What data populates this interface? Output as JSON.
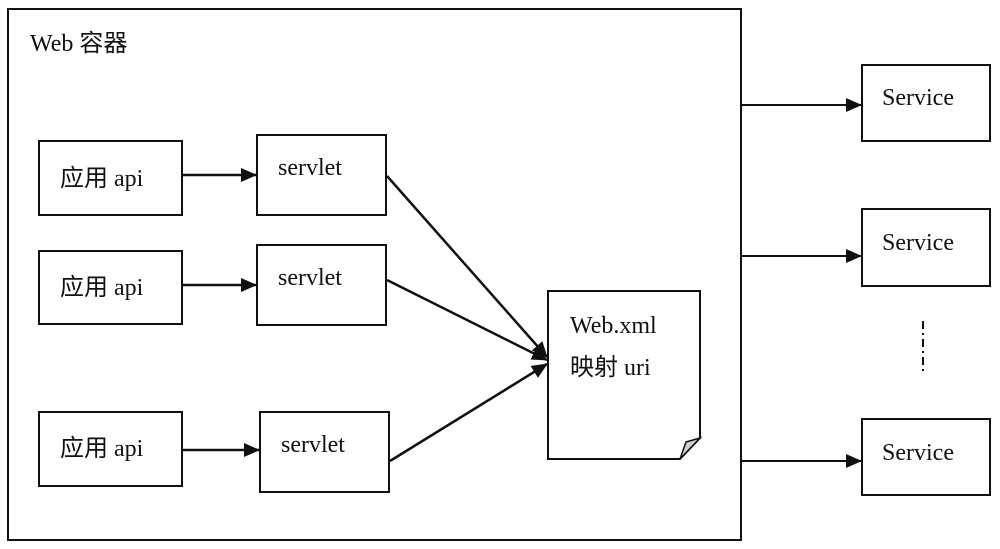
{
  "container": {
    "title": "Web 容器"
  },
  "apps": [
    {
      "label": "应用 api"
    },
    {
      "label": "应用 api"
    },
    {
      "label": "应用 api"
    }
  ],
  "servlets": [
    {
      "label": "servlet"
    },
    {
      "label": "servlet"
    },
    {
      "label": "servlet"
    }
  ],
  "mapping_doc": {
    "line1": "Web.xml",
    "line2": "映射 uri"
  },
  "services": [
    {
      "label": "Service"
    },
    {
      "label": "Service"
    },
    {
      "label": "Service"
    }
  ],
  "ellipsis": {
    "icon": "vertical-ellipsis-icon"
  },
  "edges": [
    {
      "from": "app-1",
      "to": "servlet-1"
    },
    {
      "from": "app-2",
      "to": "servlet-2"
    },
    {
      "from": "app-3",
      "to": "servlet-3"
    },
    {
      "from": "servlet-1",
      "to": "web-xml"
    },
    {
      "from": "servlet-2",
      "to": "web-xml"
    },
    {
      "from": "servlet-3",
      "to": "web-xml"
    },
    {
      "from": "web-container",
      "to": "service-1"
    },
    {
      "from": "web-container",
      "to": "service-2"
    },
    {
      "from": "web-container",
      "to": "service-3"
    }
  ]
}
